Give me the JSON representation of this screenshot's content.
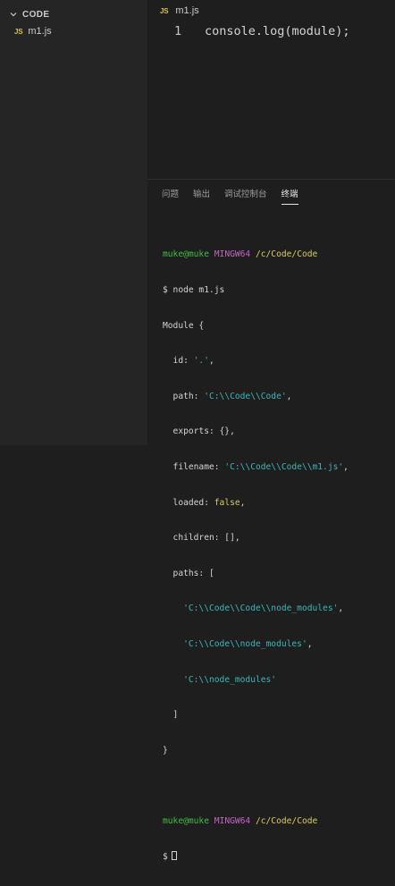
{
  "sidebar": {
    "section_title": "CODE",
    "files": [
      {
        "badge": "JS",
        "name": "m1.js"
      }
    ]
  },
  "editor": {
    "tab": {
      "badge": "JS",
      "name": "m1.js"
    },
    "lines": [
      {
        "number": "1",
        "code": "console.log(module);"
      }
    ]
  },
  "panel": {
    "tabs": [
      {
        "label": "问题",
        "active": false
      },
      {
        "label": "输出",
        "active": false
      },
      {
        "label": "调试控制台",
        "active": false
      },
      {
        "label": "终端",
        "active": true
      }
    ]
  },
  "terminal": {
    "prompt1": {
      "user": "muke@muke",
      "host": "MINGW64",
      "path": "/c/Code/Code"
    },
    "command": "$ node m1.js",
    "output": {
      "l1": "Module {",
      "id_key": "  id: ",
      "id_val": "'.'",
      "id_end": ",",
      "path_key": "  path: ",
      "path_val": "'C:\\\\Code\\\\Code'",
      "path_end": ",",
      "exports": "  exports: {},",
      "filename_key": "  filename: ",
      "filename_val": "'C:\\\\Code\\\\Code\\\\m1.js'",
      "filename_end": ",",
      "loaded_key": "  loaded: ",
      "loaded_val": "false",
      "loaded_end": ",",
      "children": "  children: [],",
      "paths_open": "  paths: [",
      "paths": [
        "'C:\\\\Code\\\\Code\\\\node_modules'",
        "'C:\\\\Code\\\\node_modules'",
        "'C:\\\\node_modules'"
      ],
      "paths_sep": ",",
      "paths_close": "  ]",
      "close": "}"
    },
    "prompt2": {
      "user": "muke@muke",
      "host": "MINGW64",
      "path": "/c/Code/Code"
    },
    "final_prompt": "$"
  },
  "colors": {
    "user": "#3fbf3f",
    "host": "#c266c2",
    "path": "#d7ce5a",
    "string": "#3ab8b8",
    "keyword": "#d7ce5a",
    "js_badge": "#d8c23f"
  }
}
